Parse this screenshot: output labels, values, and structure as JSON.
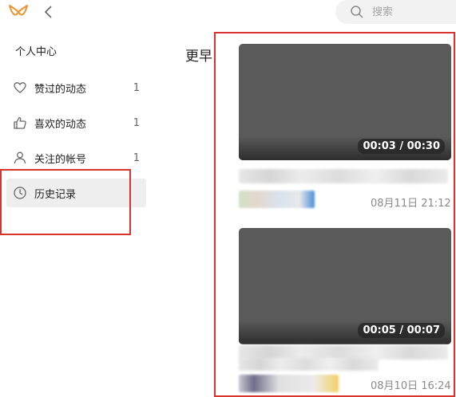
{
  "search": {
    "placeholder": "搜索"
  },
  "sidebar": {
    "title": "个人中心",
    "items": [
      {
        "label": "赞过的动态",
        "count": "1",
        "icon": "heart-icon"
      },
      {
        "label": "喜欢的动态",
        "count": "1",
        "icon": "thumbs-up-icon"
      },
      {
        "label": "关注的帐号",
        "count": "1",
        "icon": "user-icon"
      },
      {
        "label": "历史记录",
        "count": "",
        "icon": "clock-icon",
        "active": true
      }
    ]
  },
  "main": {
    "section_title": "更早",
    "videos": [
      {
        "duration": "00:03 / 00:30",
        "date": "08月11日 21:12"
      },
      {
        "duration": "00:05 / 00:07",
        "date": "08月10日 16:24"
      }
    ]
  },
  "colors": {
    "highlight": "#d8332c",
    "logo": "#f0912a",
    "active_bg": "#eeeeee"
  }
}
